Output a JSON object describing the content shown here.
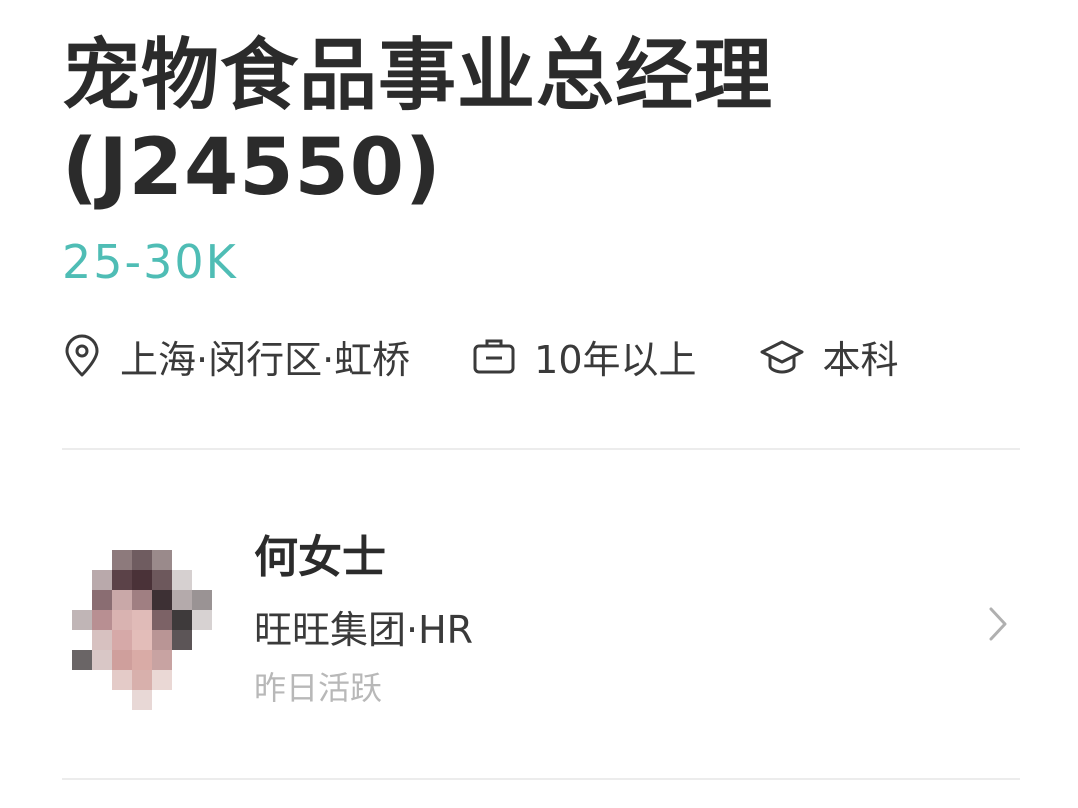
{
  "job": {
    "title": "宠物食品事业总经理(J24550)",
    "salary": "25-30K",
    "location": "上海·闵行区·虹桥",
    "experience": "10年以上",
    "education": "本科"
  },
  "icons": {
    "location": "location-pin-icon",
    "experience": "briefcase-icon",
    "education": "graduation-cap-icon",
    "chevron": "chevron-right-icon"
  },
  "recruiter": {
    "name": "何女士",
    "company_role": "旺旺集团·HR",
    "active_status": "昨日活跃"
  },
  "colors": {
    "salary": "#4fbdb5",
    "title": "#2b2b2b",
    "secondary_text": "#b8b8b8",
    "divider": "#ececec"
  }
}
